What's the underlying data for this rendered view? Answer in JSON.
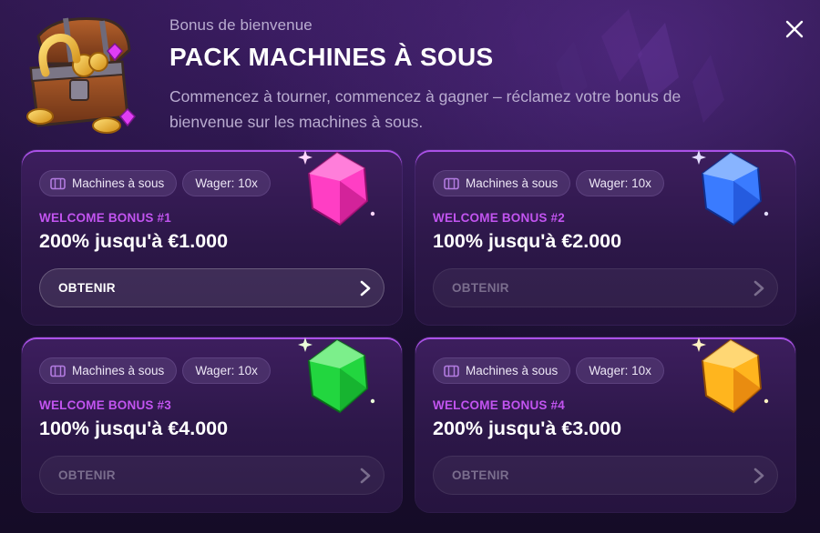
{
  "header": {
    "subtitle": "Bonus de bienvenue",
    "title": "PACK MACHINES À SOUS",
    "description": "Commencez à tourner, commencez à gagner – réclamez votre bonus de bienvenue sur les machines à sous."
  },
  "cards": [
    {
      "category": "Machines à sous",
      "wager": "Wager: 10x",
      "label": "WELCOME BONUS #1",
      "amount": "200% jusqu'à €1.000",
      "button": "OBTENIR",
      "gem_color": "#ff3ec4"
    },
    {
      "category": "Machines à sous",
      "wager": "Wager: 10x",
      "label": "WELCOME BONUS #2",
      "amount": "100% jusqu'à €2.000",
      "button": "OBTENIR",
      "gem_color": "#3a7bff"
    },
    {
      "category": "Machines à sous",
      "wager": "Wager: 10x",
      "label": "WELCOME BONUS #3",
      "amount": "100% jusqu'à €4.000",
      "button": "OBTENIR",
      "gem_color": "#22d63f"
    },
    {
      "category": "Machines à sous",
      "wager": "Wager: 10x",
      "label": "WELCOME BONUS #4",
      "amount": "200% jusqu'à €3.000",
      "button": "OBTENIR",
      "gem_color": "#ffb51e"
    }
  ],
  "colors": {
    "accent": "#c254f0",
    "background": "#1a0f2e",
    "card": "#2c1748"
  },
  "icons": [
    "treasure-chest-icon",
    "close-icon",
    "slot-machine-icon",
    "chevron-right-icon",
    "pink-gem-icon",
    "blue-gem-icon",
    "green-gem-icon",
    "orange-gem-icon"
  ]
}
